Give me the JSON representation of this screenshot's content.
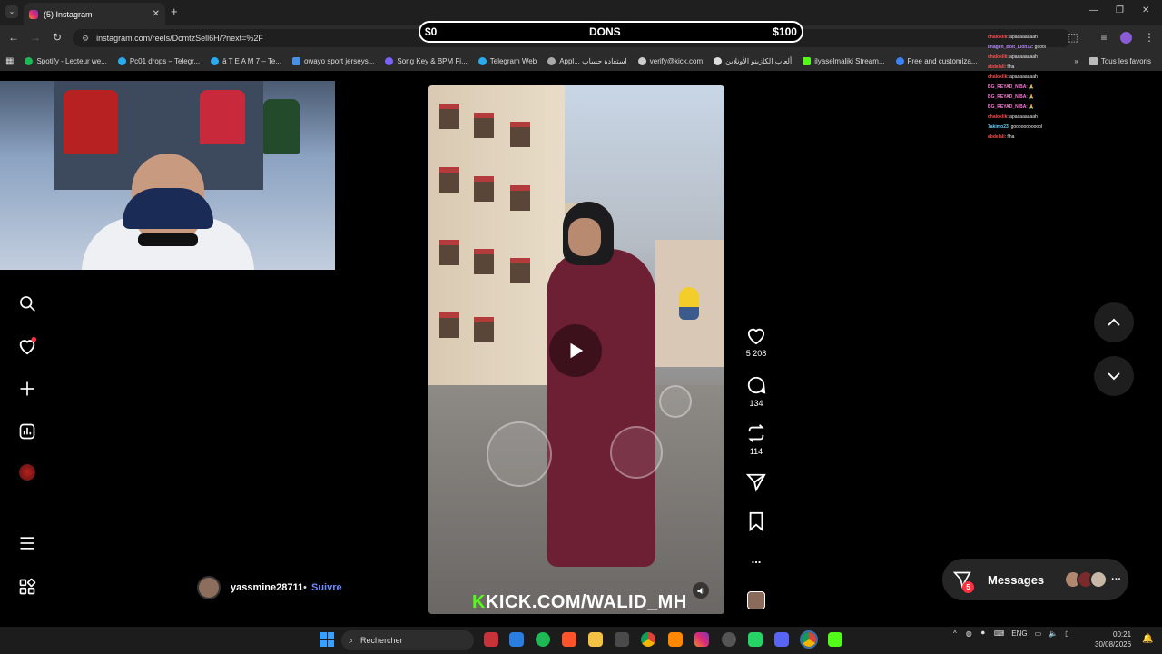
{
  "browser": {
    "tab_title": "(5) Instagram",
    "url": "instagram.com/reels/DcmtzSell6H/?next=%2F",
    "bookmarks": [
      {
        "label": "Spotify - Lecteur we...",
        "color": "#1db954"
      },
      {
        "label": "Pc01 drops – Telegr...",
        "color": "#2aabee"
      },
      {
        "label": "ā T E A M 7 – Te...",
        "color": "#2aabee"
      },
      {
        "label": "owayo sport jerseys...",
        "color": "#4a90e2"
      },
      {
        "label": "Song Key & BPM Fi...",
        "color": "#7b61ff"
      },
      {
        "label": "Telegram Web",
        "color": "#2aabee"
      },
      {
        "label": "Appl... استعادة حساب",
        "color": "#aaaaaa"
      },
      {
        "label": "verify@kick.com",
        "color": "#cccccc"
      },
      {
        "label": "ألعاب الكازينو الأونلاين",
        "color": "#dddddd"
      },
      {
        "label": "ilyaselmaliki Stream...",
        "color": "#53fc18"
      },
      {
        "label": "Free and customiza...",
        "color": "#3b82f6"
      }
    ],
    "all_bookmarks": "Tous les favoris"
  },
  "donation": {
    "left": "$0",
    "center": "DONS",
    "right": "$100"
  },
  "reel": {
    "username": "yassmine28711",
    "separator": "•",
    "follow": "Suivre",
    "likes": "5 208",
    "comments": "134",
    "reposts": "114",
    "more": "...",
    "watermark_k": "K",
    "watermark_text": "KICK.COM/WALID_MH"
  },
  "chat": [
    {
      "name": "chaloklik",
      "text": ": apaaaaaaaah",
      "color": "#ff4d4d"
    },
    {
      "name": "Imagen_Bolt_Lion12",
      "text": ": goool",
      "color": "#b784ff"
    },
    {
      "name": "chaloklik",
      "text": ": apaaaaaaaah",
      "color": "#ff4d4d"
    },
    {
      "name": "abdelali",
      "text": ": fiha",
      "color": "#ff4d4d"
    },
    {
      "name": "chaloklik",
      "text": ": apaaaaaaaah",
      "color": "#ff4d4d"
    },
    {
      "name": "BG_REYAD_NIBA",
      "text": ": 🙏",
      "color": "#ff7ad9"
    },
    {
      "name": "BG_REYAD_NIBA",
      "text": ": 🙏",
      "color": "#ff7ad9"
    },
    {
      "name": "BG_REYAD_NIBA",
      "text": ": 🙏",
      "color": "#ff7ad9"
    },
    {
      "name": "chaloklik",
      "text": ": apaaaaaaaah",
      "color": "#ff4d4d"
    },
    {
      "name": "7akimo23",
      "text": ": goooooooooool",
      "color": "#6ad0ff"
    },
    {
      "name": "abdelali",
      "text": ": fiha",
      "color": "#ff4d4d"
    }
  ],
  "messages": {
    "label": "Messages",
    "badge": "5",
    "more": "···"
  },
  "taskbar": {
    "search": "Rechercher",
    "lang": "ENG",
    "time": "00:21",
    "date": "30/08/2026"
  }
}
